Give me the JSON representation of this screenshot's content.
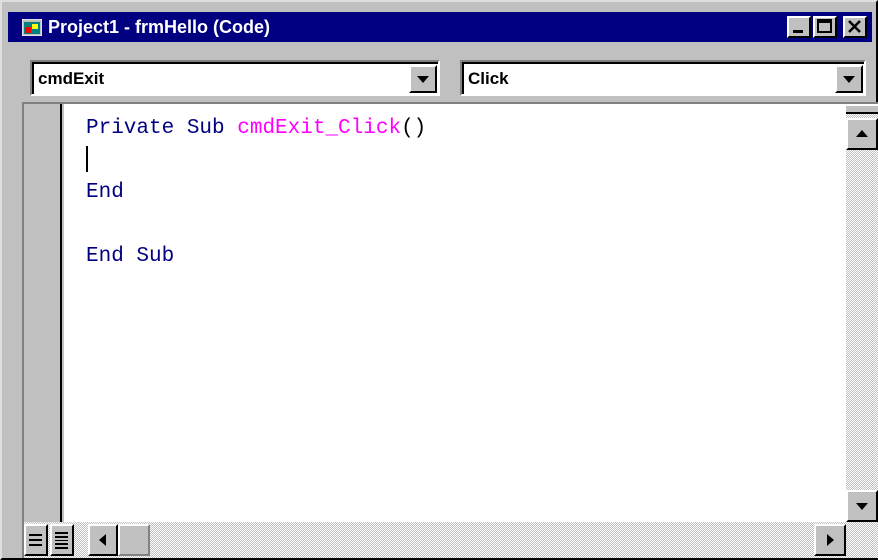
{
  "window": {
    "title": "Project1 - frmHello (Code)",
    "title_icon": "form-module-icon",
    "caption_buttons": [
      "minimize",
      "maximize",
      "close"
    ]
  },
  "object_combo": {
    "value": "cmdExit"
  },
  "procedure_combo": {
    "value": "Click"
  },
  "code": {
    "line1_keywords": "Private Sub ",
    "line1_procname": "cmdExit_Click",
    "line1_parens": "()",
    "line2": "",
    "line3": "End",
    "line4": "",
    "line5": "End Sub"
  },
  "colors": {
    "titlebar": "#000080",
    "keyword": "#000080",
    "procedure_name": "#ff00ff",
    "editor_bg": "#ffffff",
    "chrome": "#c0c0c0"
  },
  "view_buttons": [
    "procedure-view-icon",
    "full-module-view-icon"
  ]
}
